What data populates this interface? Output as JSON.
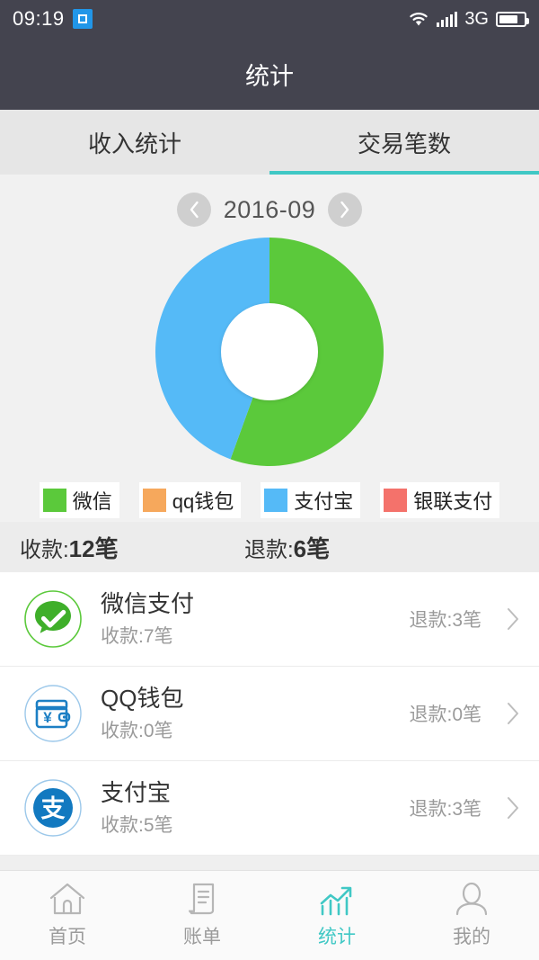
{
  "statusbar": {
    "time": "09:19",
    "network_label": "3G",
    "icons": [
      "screenshot-icon",
      "wifi-icon",
      "signal-icon",
      "battery-icon"
    ]
  },
  "header": {
    "title": "统计"
  },
  "tabs": [
    {
      "label": "收入统计",
      "active": false
    },
    {
      "label": "交易笔数",
      "active": true
    }
  ],
  "month_selector": {
    "prev_label": "‹",
    "value": "2016-09",
    "next_label": "›"
  },
  "legend": [
    {
      "label": "微信",
      "color": "#5bc93b"
    },
    {
      "label": "qq钱包",
      "color": "#f6a85c"
    },
    {
      "label": "支付宝",
      "color": "#55baf7"
    },
    {
      "label": "银联支付",
      "color": "#f4726b"
    }
  ],
  "summary": {
    "received_prefix": "收款:",
    "received_value": "12笔",
    "refund_prefix": "退款:",
    "refund_value": "6笔"
  },
  "list": [
    {
      "icon": "wechat-pay-icon",
      "title": "微信支付",
      "received": "收款:7笔",
      "refund": "退款:3笔",
      "chevron": "chevron-right-icon"
    },
    {
      "icon": "qq-wallet-icon",
      "title": "QQ钱包",
      "received": "收款:0笔",
      "refund": "退款:0笔",
      "chevron": "chevron-right-icon"
    },
    {
      "icon": "alipay-icon",
      "title": "支付宝",
      "received": "收款:5笔",
      "refund": "退款:3笔",
      "chevron": "chevron-right-icon"
    }
  ],
  "bottomnav": [
    {
      "label": "首页",
      "icon": "home-icon",
      "active": false
    },
    {
      "label": "账单",
      "icon": "receipt-icon",
      "active": false
    },
    {
      "label": "统计",
      "icon": "chart-icon",
      "active": true
    },
    {
      "label": "我的",
      "icon": "person-icon",
      "active": false
    }
  ],
  "theme": {
    "accent": "#40c8c5",
    "header_bg": "#44444f",
    "page_bg": "#efefef"
  },
  "chart_data": {
    "type": "pie",
    "title": "交易笔数",
    "subtitle": "2016-09",
    "donut": true,
    "labels": [
      "微信",
      "qq钱包",
      "支付宝",
      "银联支付"
    ],
    "values": [
      10,
      0,
      8,
      0
    ],
    "percentages": [
      55.6,
      0,
      44.4,
      0
    ],
    "colors": [
      "#5bc93b",
      "#f6a85c",
      "#55baf7",
      "#f4726b"
    ],
    "legend_position": "bottom",
    "start_angle": 0,
    "annotations": [
      "收款:12笔",
      "退款:6笔"
    ]
  }
}
